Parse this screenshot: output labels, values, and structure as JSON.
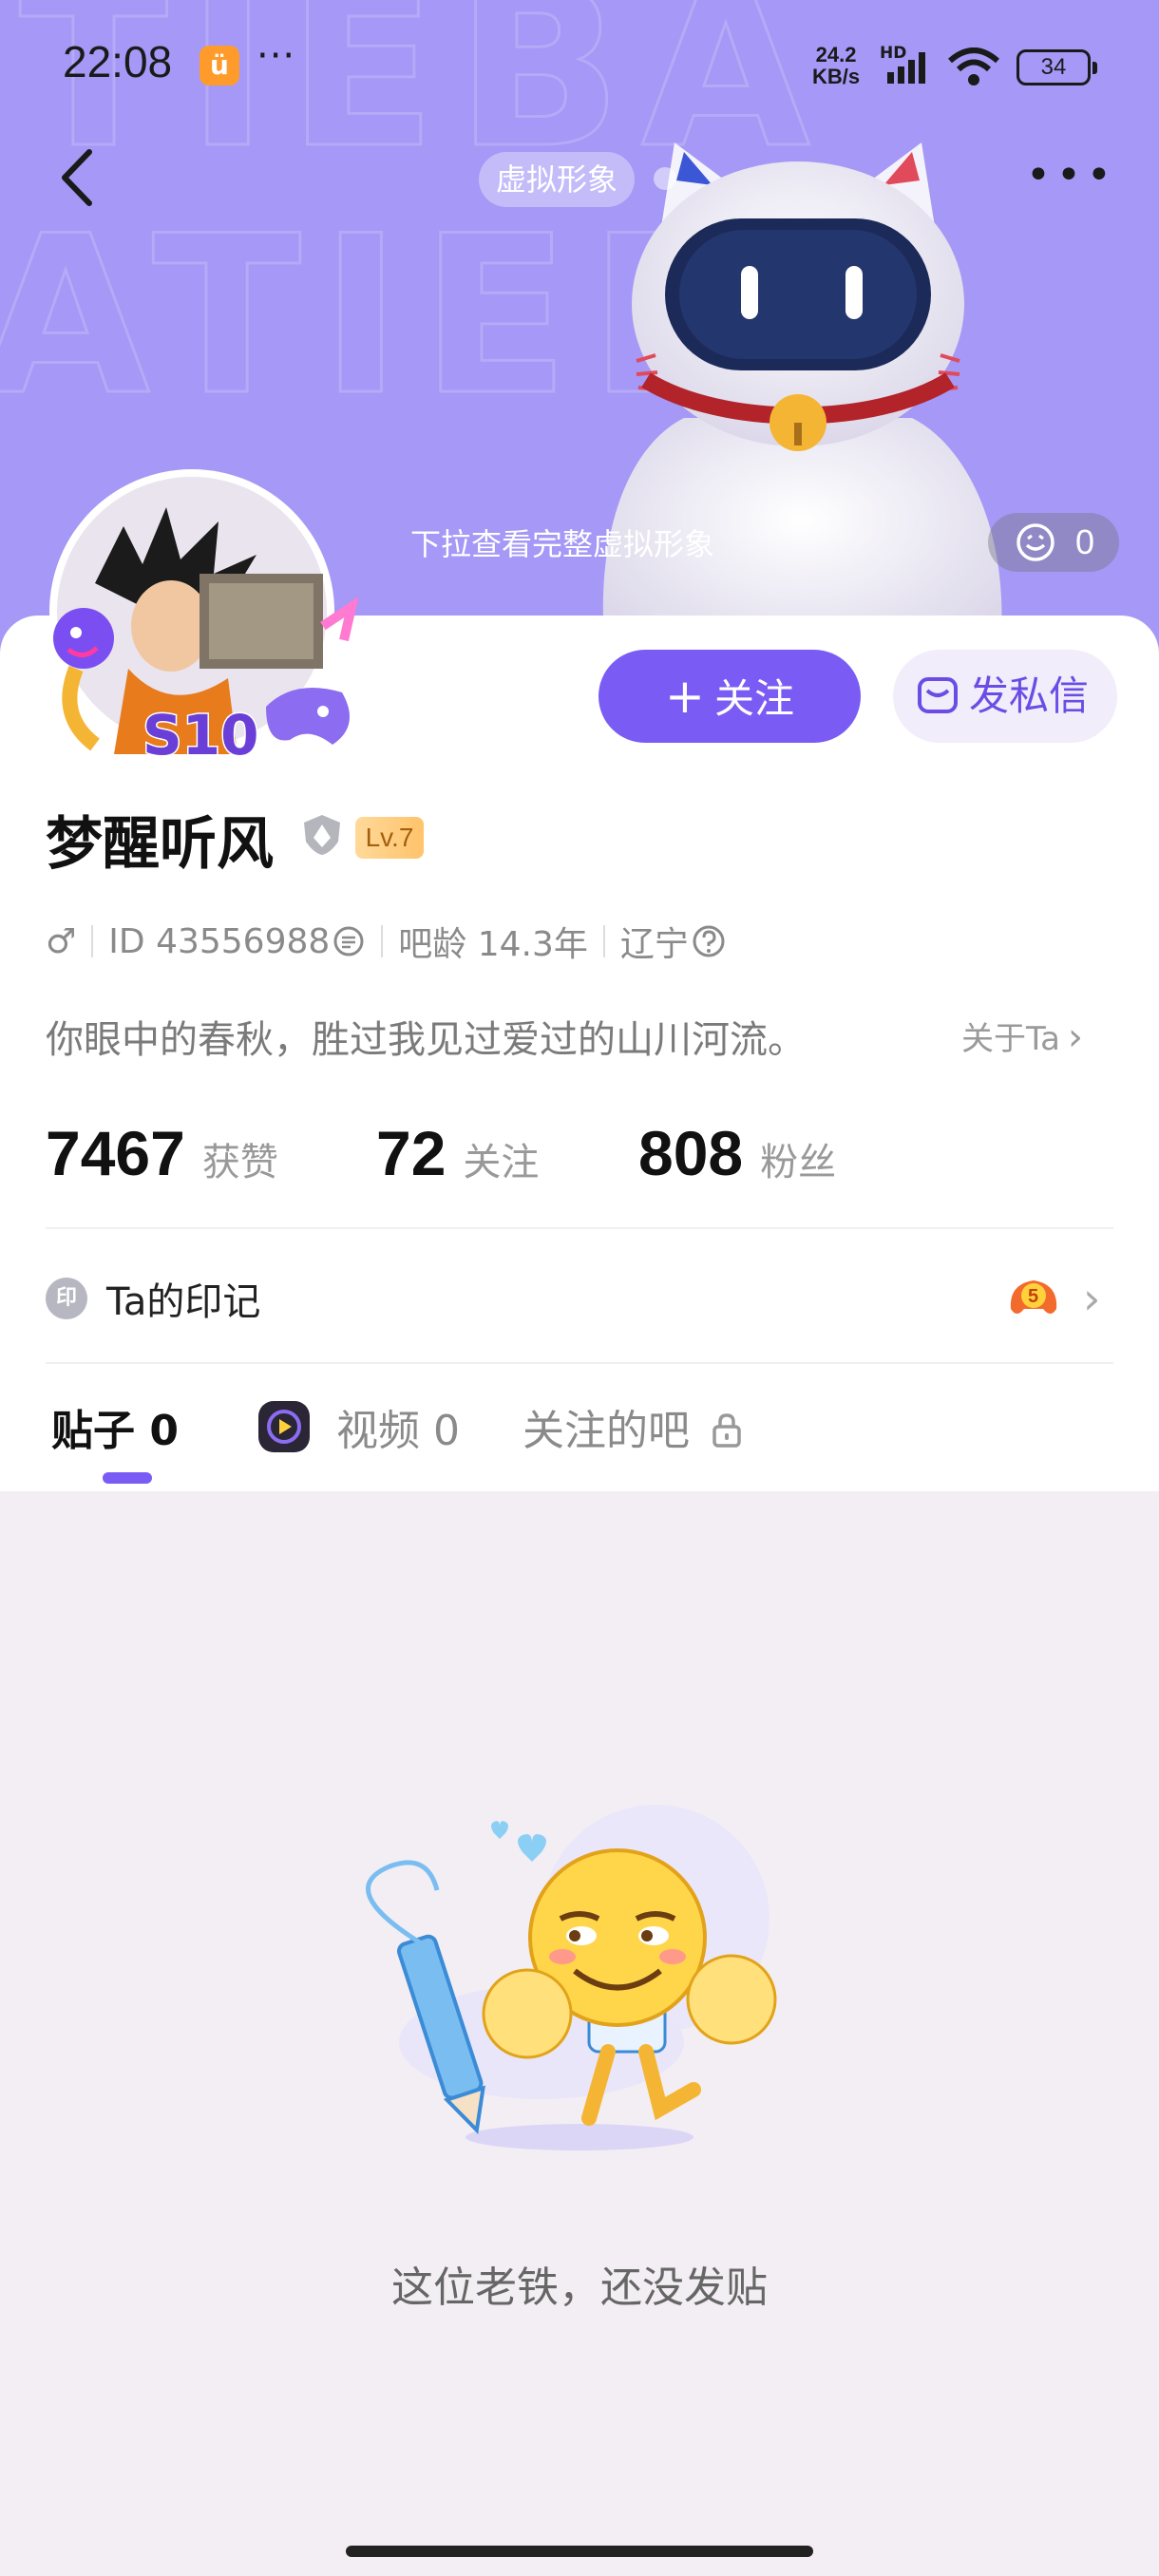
{
  "status_bar": {
    "time": "22:08",
    "app_icon_glyph": "ü",
    "more_dots": "···",
    "net_speed_value": "24.2",
    "net_speed_unit": "KB/s",
    "network_label": "HD",
    "battery": "34"
  },
  "header": {
    "avatar_tag": "虚拟形象",
    "pull_hint": "下拉查看完整虚拟形象",
    "like_count": "0",
    "more_label": "•••"
  },
  "profile": {
    "avatar_badge_text": "S10",
    "follow_label": "关注",
    "message_label": "发私信",
    "username": "梦醒听风",
    "level": "Lv.7",
    "gender_symbol": "♂",
    "id_text": "ID 43556988",
    "bar_age": "吧龄 14.3年",
    "region": "辽宁",
    "bio": "你眼中的春秋，胜过我见过爱过的山川河流。",
    "about_label": "关于Ta"
  },
  "stats": [
    {
      "value": "7467",
      "label": "获赞"
    },
    {
      "value": "72",
      "label": "关注"
    },
    {
      "value": "808",
      "label": "粉丝"
    }
  ],
  "imprint": {
    "badge_char": "印",
    "label": "Ta的印记",
    "medal_number": "5"
  },
  "tabs": [
    {
      "label": "贴子",
      "count": "0",
      "active": true
    },
    {
      "label": "视频",
      "count": "0",
      "active": false
    },
    {
      "label": "关注的吧",
      "count": "",
      "active": false
    }
  ],
  "empty_state": {
    "message": "这位老铁，还没发贴"
  },
  "colors": {
    "banner": "#a598f6",
    "accent": "#7a5cf5",
    "background": "#f3eef3"
  }
}
